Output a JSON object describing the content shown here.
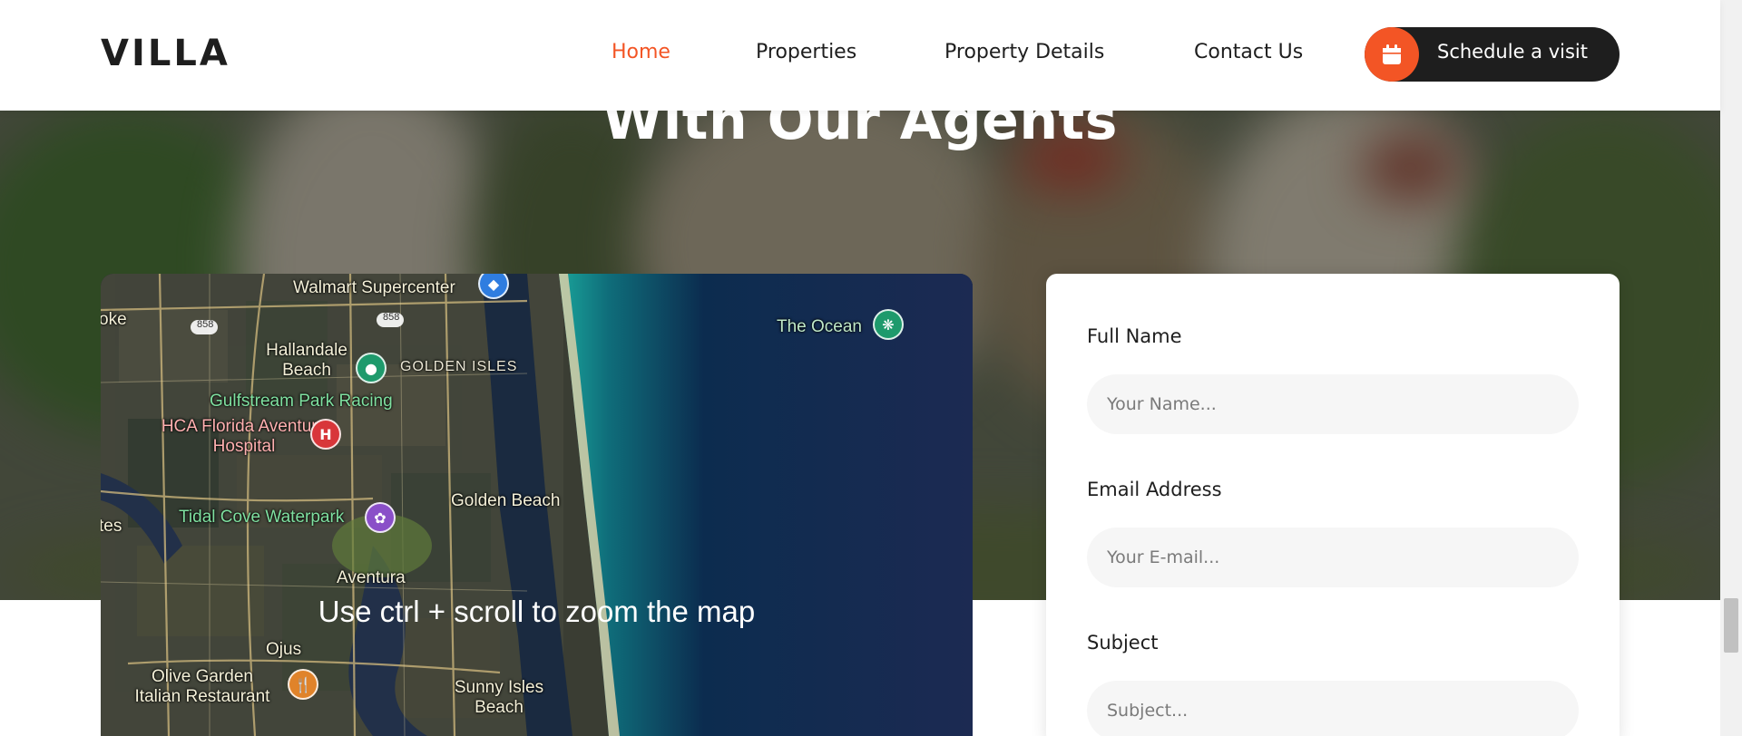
{
  "header": {
    "logo": "VILLA",
    "nav": [
      {
        "label": "Home",
        "active": true
      },
      {
        "label": "Properties",
        "active": false
      },
      {
        "label": "Property Details",
        "active": false
      },
      {
        "label": "Contact Us",
        "active": false
      }
    ],
    "cta_label": "Schedule a visit",
    "cta_icon": "calendar-icon"
  },
  "hero": {
    "title": "With Our Agents"
  },
  "map": {
    "hint": "Use ctrl + scroll to zoom the map",
    "labels": {
      "walmart": "Walmart Supercenter",
      "hallandale": "Hallandale Beach",
      "golden_isles": "GOLDEN ISLES",
      "gulfstream": "Gulfstream Park Racing",
      "hca": "HCA Florida Aventura Hospital",
      "tidal_cove": "Tidal Cove Waterpark",
      "golden_beach": "Golden Beach",
      "aventura": "Aventura",
      "ojus": "Ojus",
      "olive_garden": "Olive Garden Italian Restaurant",
      "sunny_isles": "Sunny Isles Beach",
      "the_ocean": "The Ocean",
      "road_858a": "858",
      "road_858b": "858",
      "edge_oke": "oke",
      "edge_tes": "tes"
    }
  },
  "form": {
    "fields": [
      {
        "label": "Full Name",
        "placeholder": "Your Name..."
      },
      {
        "label": "Email Address",
        "placeholder": "Your E-mail..."
      },
      {
        "label": "Subject",
        "placeholder": "Subject..."
      }
    ]
  },
  "colors": {
    "accent": "#f35525",
    "dark": "#1e1e1e",
    "input_bg": "#f6f6f6"
  }
}
